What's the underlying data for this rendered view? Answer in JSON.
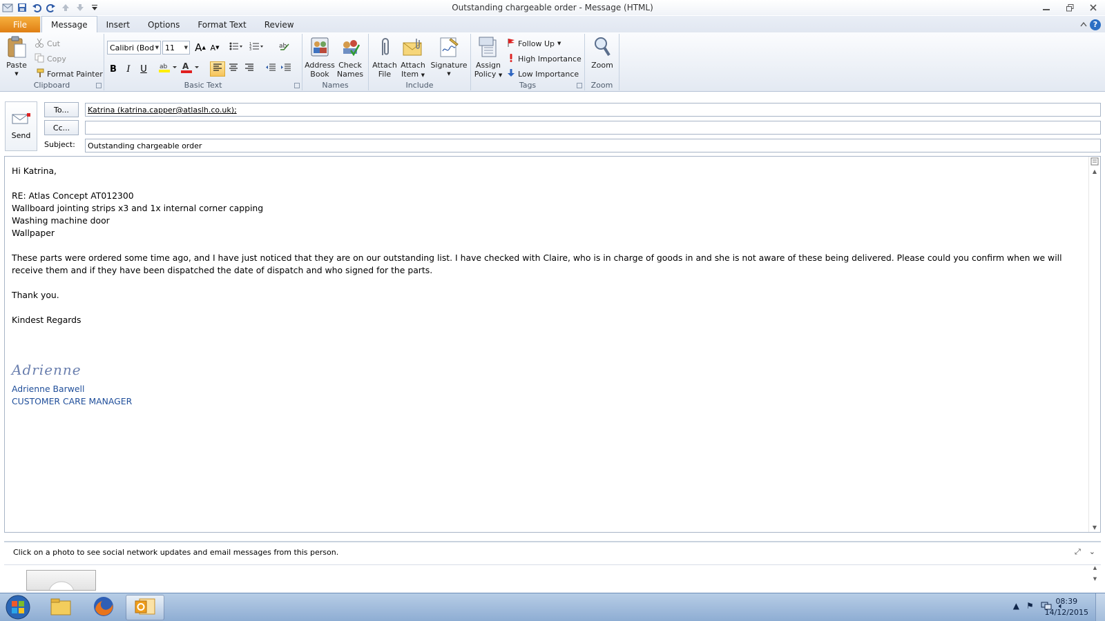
{
  "window": {
    "title": "Outstanding chargeable order  -  Message (HTML)"
  },
  "ribbon": {
    "tabs": [
      "File",
      "Message",
      "Insert",
      "Options",
      "Format Text",
      "Review"
    ],
    "clipboard": {
      "label": "Clipboard",
      "paste": "Paste",
      "cut": "Cut",
      "copy": "Copy",
      "format_painter": "Format Painter"
    },
    "basic_text": {
      "label": "Basic Text",
      "font": "Calibri (Body)",
      "size": "11",
      "bold": "B",
      "italic": "I",
      "underline": "U",
      "grow": "A",
      "shrink": "A"
    },
    "names": {
      "label": "Names",
      "address_book": [
        "Address",
        "Book"
      ],
      "check_names": [
        "Check",
        "Names"
      ]
    },
    "include": {
      "label": "Include",
      "attach_file": [
        "Attach",
        "File"
      ],
      "attach_item": [
        "Attach",
        "Item"
      ],
      "signature": "Signature"
    },
    "tags": {
      "label": "Tags",
      "assign_policy": [
        "Assign",
        "Policy"
      ],
      "follow_up": "Follow Up",
      "high_importance": "High Importance",
      "low_importance": "Low Importance"
    },
    "zoom": {
      "label": "Zoom",
      "zoom": "Zoom"
    }
  },
  "header": {
    "send": "Send",
    "to_button": "To...",
    "cc_button": "Cc...",
    "to_value": "Katrina (katrina.capper@atlaslh.co.uk);",
    "cc_value": "",
    "subject_label": "Subject:",
    "subject_value": "Outstanding chargeable order"
  },
  "body": {
    "greeting": "Hi Katrina,",
    "lines": [
      "RE: Atlas Concept AT012300",
      "Wallboard jointing strips x3 and 1x internal corner capping",
      "Washing machine door",
      "Wallpaper"
    ],
    "paragraph_1": "These parts were ordered some time ago, and I have just noticed that they are on our outstanding list.  I have checked with Claire, who is in charge of goods in and she is not aware of these being delivered.  Please could you confirm when we will receive them and if they have been dispatched the date of dispatch and who signed for the parts.",
    "thanks": "Thank you.",
    "closing": "Kindest Regards",
    "signature_script": "Adrienne",
    "signature_name": "Adrienne Barwell",
    "signature_title": "CUSTOMER CARE MANAGER"
  },
  "people_pane": {
    "message": "Click on a photo to see social network updates and email messages from this person."
  },
  "taskbar": {
    "time": "08:39",
    "date": "14/12/2015"
  },
  "colors": {
    "file_tab": "#e8891c",
    "signature": "#1f4e9a",
    "taskbar": "#9db8da"
  }
}
